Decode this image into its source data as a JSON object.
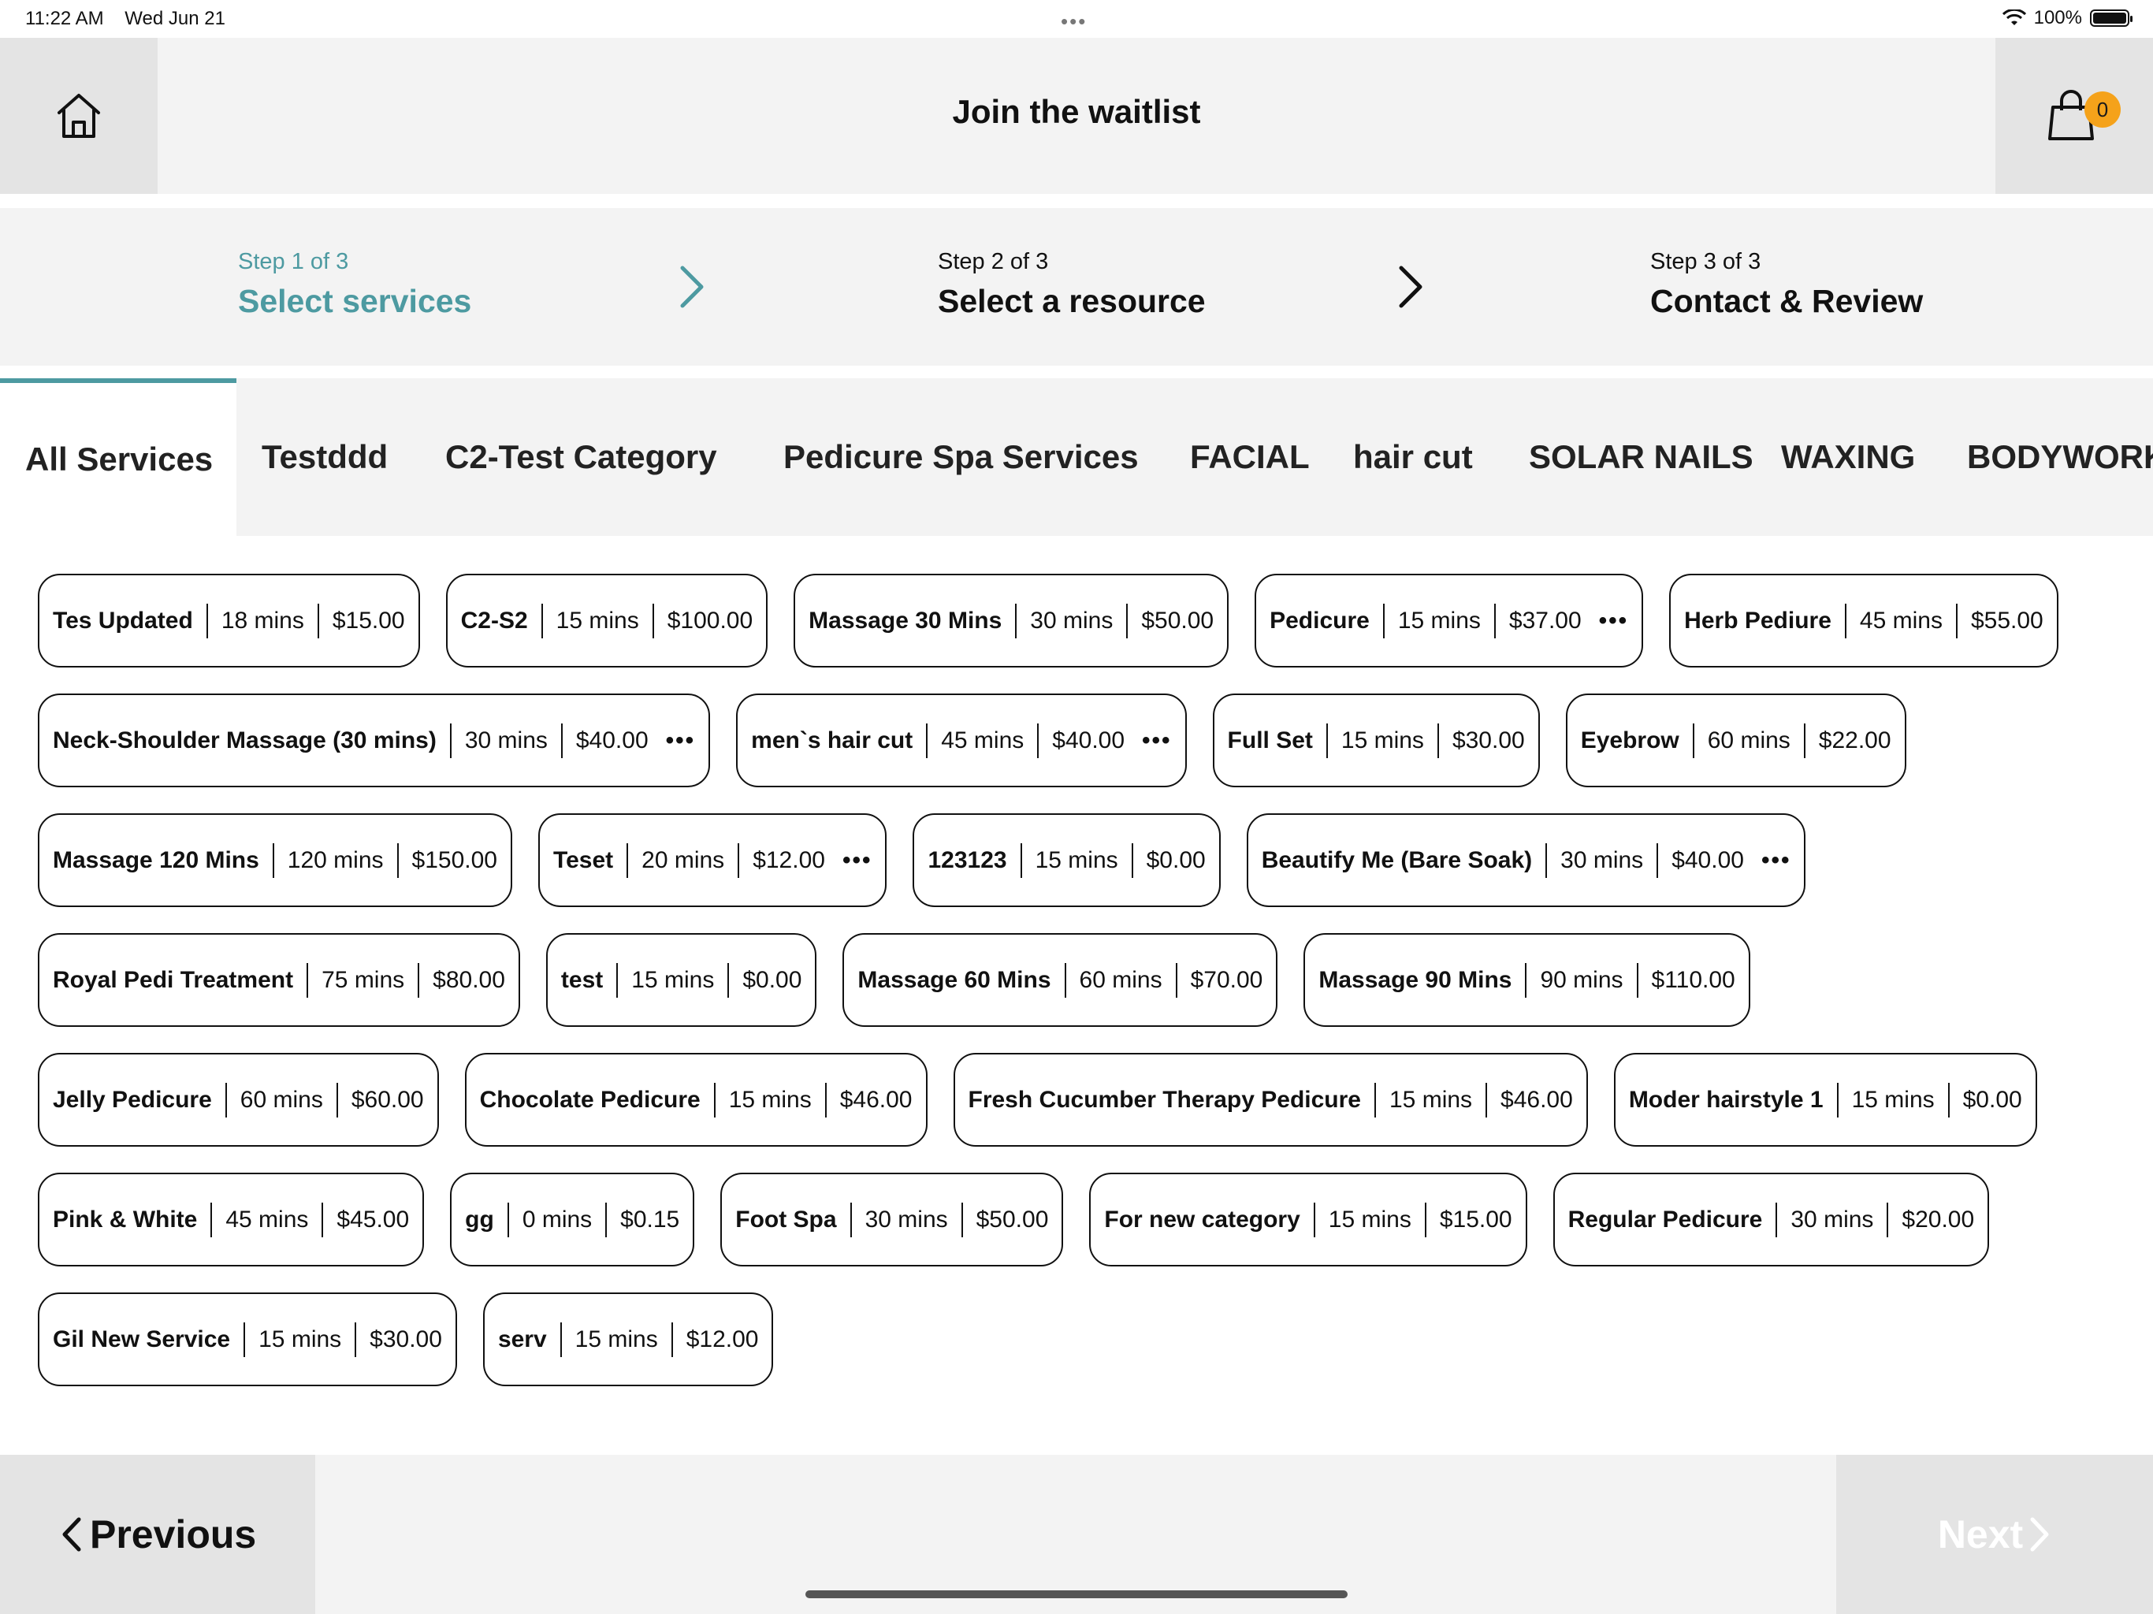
{
  "status_bar": {
    "time": "11:22 AM",
    "date": "Wed Jun 21",
    "battery": "100%"
  },
  "header": {
    "title": "Join the waitlist",
    "cart_count": "0"
  },
  "steps": [
    {
      "sub": "Step 1 of 3",
      "main": "Select services"
    },
    {
      "sub": "Step 2 of 3",
      "main": "Select a resource"
    },
    {
      "sub": "Step 3 of 3",
      "main": "Contact & Review"
    }
  ],
  "tabs": [
    "All Services",
    "Testddd",
    "C2-Test Category",
    "Pedicure Spa Services",
    "FACIAL",
    "hair cut",
    "SOLAR NAILS",
    "WAXING",
    "BODYWORK"
  ],
  "services": [
    {
      "name": "Tes Updated",
      "duration": "18 mins",
      "price": "$15.00"
    },
    {
      "name": "C2-S2",
      "duration": "15 mins",
      "price": "$100.00"
    },
    {
      "name": "Massage 30 Mins",
      "duration": "30 mins",
      "price": "$50.00"
    },
    {
      "name": "Pedicure",
      "duration": "15 mins",
      "price": "$37.00",
      "more": "•••"
    },
    {
      "name": "Herb Pediure",
      "duration": "45 mins",
      "price": "$55.00"
    },
    {
      "name": "Neck-Shoulder Massage (30 mins)",
      "duration": "30 mins",
      "price": "$40.00",
      "more": "•••"
    },
    {
      "name": "men`s hair cut",
      "duration": "45 mins",
      "price": "$40.00",
      "more": "•••"
    },
    {
      "name": "Full Set",
      "duration": "15 mins",
      "price": "$30.00"
    },
    {
      "name": "Eyebrow",
      "duration": "60 mins",
      "price": "$22.00"
    },
    {
      "name": "Massage 120 Mins",
      "duration": "120 mins",
      "price": "$150.00"
    },
    {
      "name": "Teset",
      "duration": "20 mins",
      "price": "$12.00",
      "more": "•••"
    },
    {
      "name": "123123",
      "duration": "15 mins",
      "price": "$0.00"
    },
    {
      "name": "Beautify Me (Bare Soak)",
      "duration": "30 mins",
      "price": "$40.00",
      "more": "•••"
    },
    {
      "name": "Royal Pedi Treatment",
      "duration": "75 mins",
      "price": "$80.00"
    },
    {
      "name": "test",
      "duration": "15 mins",
      "price": "$0.00"
    },
    {
      "name": "Massage 60 Mins",
      "duration": "60 mins",
      "price": "$70.00"
    },
    {
      "name": "Massage 90 Mins",
      "duration": "90 mins",
      "price": "$110.00"
    },
    {
      "name": "Jelly Pedicure",
      "duration": "60 mins",
      "price": "$60.00"
    },
    {
      "name": "Chocolate Pedicure",
      "duration": "15 mins",
      "price": "$46.00"
    },
    {
      "name": "Fresh Cucumber Therapy Pedicure",
      "duration": "15 mins",
      "price": "$46.00"
    },
    {
      "name": "Moder hairstyle 1",
      "duration": "15 mins",
      "price": "$0.00"
    },
    {
      "name": "Pink & White",
      "duration": "45 mins",
      "price": "$45.00"
    },
    {
      "name": "gg",
      "duration": "0 mins",
      "price": "$0.15"
    },
    {
      "name": "Foot Spa",
      "duration": "30 mins",
      "price": "$50.00"
    },
    {
      "name": "For new category",
      "duration": "15 mins",
      "price": "$15.00"
    },
    {
      "name": "Regular Pedicure",
      "duration": "30 mins",
      "price": "$20.00"
    },
    {
      "name": "Gil New Service",
      "duration": "15 mins",
      "price": "$30.00"
    },
    {
      "name": "serv",
      "duration": "15 mins",
      "price": "$12.00"
    }
  ],
  "footer": {
    "previous_label": "Previous",
    "next_label": "Next"
  },
  "colors": {
    "accent": "#4d9aa1",
    "badge": "#f5a21a",
    "panel": "#f3f3f3"
  },
  "icons": [
    "home-icon",
    "shopping-bag-icon",
    "chevron-right-icon",
    "chevron-left-icon",
    "wifi-icon",
    "battery-icon",
    "more-icon"
  ]
}
